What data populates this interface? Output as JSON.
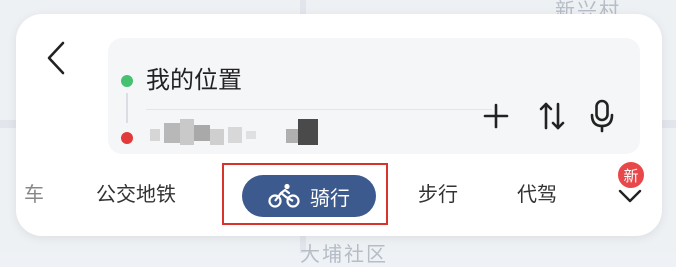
{
  "map": {
    "label_top": "新兴村",
    "label_bottom": "大埔社区"
  },
  "header": {
    "back_icon": "chevron-left-icon"
  },
  "route": {
    "origin": "我的位置",
    "destination_obscured": true,
    "actions": [
      {
        "icon": "plus-icon"
      },
      {
        "icon": "swap-vertical-icon"
      },
      {
        "icon": "microphone-icon"
      }
    ]
  },
  "transport_tabs": {
    "items": [
      {
        "label": "车",
        "partial": true
      },
      {
        "label": "公交地铁"
      },
      {
        "label": "骑行",
        "active": true,
        "icon": "bicycle-icon"
      },
      {
        "label": "步行"
      },
      {
        "label": "代驾"
      }
    ],
    "more_icon": "chevron-down-icon",
    "badge": "新"
  },
  "colors": {
    "active_tab_bg": "#3d5a8e",
    "highlight_border": "#d8342c",
    "origin_dot": "#46c171",
    "destination_dot": "#e23a3a",
    "badge": "#e9484a"
  }
}
